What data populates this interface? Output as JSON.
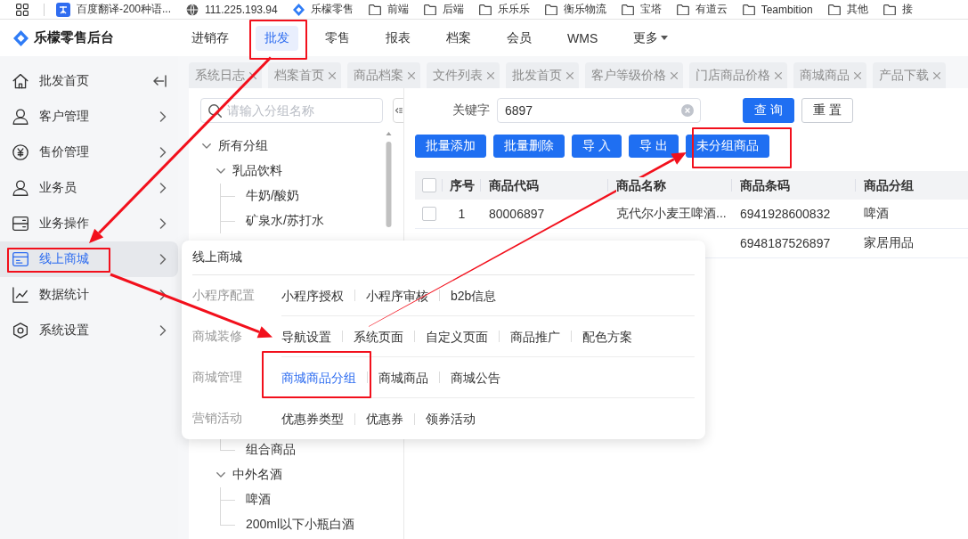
{
  "bookmarks_bar": {
    "items": [
      {
        "kind": "page",
        "label": "百度翻译-200种语..."
      },
      {
        "kind": "page",
        "label": "111.225.193.94"
      },
      {
        "kind": "page",
        "label": "乐檬零售"
      },
      {
        "kind": "folder",
        "label": "前端"
      },
      {
        "kind": "folder",
        "label": "后端"
      },
      {
        "kind": "folder",
        "label": "乐乐乐"
      },
      {
        "kind": "folder",
        "label": "衡乐物流"
      },
      {
        "kind": "folder",
        "label": "宝塔"
      },
      {
        "kind": "folder",
        "label": "有道云"
      },
      {
        "kind": "folder",
        "label": "Teambition"
      },
      {
        "kind": "folder",
        "label": "其他"
      },
      {
        "kind": "folder",
        "label": "接"
      }
    ]
  },
  "header": {
    "title": "乐檬零售后台",
    "nav": [
      {
        "label": "进销存",
        "kind": "link",
        "selected": false,
        "highlighted": false
      },
      {
        "label": "批发",
        "kind": "link",
        "selected": true,
        "highlighted": true
      },
      {
        "label": "零售",
        "kind": "link",
        "selected": false,
        "highlighted": false
      },
      {
        "label": "报表",
        "kind": "link",
        "selected": false,
        "highlighted": false
      },
      {
        "label": "档案",
        "kind": "link",
        "selected": false,
        "highlighted": false
      },
      {
        "label": "会员",
        "kind": "link",
        "selected": false,
        "highlighted": false
      },
      {
        "label": "WMS",
        "kind": "link",
        "selected": false,
        "highlighted": false
      },
      {
        "label": "更多",
        "kind": "menu",
        "selected": false,
        "highlighted": false
      }
    ]
  },
  "sidebar": {
    "items": [
      {
        "label": "批发首页",
        "selected": false,
        "highlighted": false
      },
      {
        "label": "客户管理",
        "selected": false,
        "highlighted": false
      },
      {
        "label": "售价管理",
        "selected": false,
        "highlighted": false
      },
      {
        "label": "业务员",
        "selected": false,
        "highlighted": false
      },
      {
        "label": "业务操作",
        "selected": false,
        "highlighted": false
      },
      {
        "label": "线上商城",
        "selected": true,
        "highlighted": true
      },
      {
        "label": "数据统计",
        "selected": false,
        "highlighted": false
      },
      {
        "label": "系统设置",
        "selected": false,
        "highlighted": false
      }
    ]
  },
  "tabs": [
    {
      "label": "系统日志",
      "closable": true
    },
    {
      "label": "档案首页",
      "closable": true
    },
    {
      "label": "商品档案",
      "closable": true
    },
    {
      "label": "文件列表",
      "closable": true
    },
    {
      "label": "批发首页",
      "closable": true
    },
    {
      "label": "客户等级价格",
      "closable": true
    },
    {
      "label": "门店商品价格",
      "closable": true
    },
    {
      "label": "商城商品",
      "closable": true
    },
    {
      "label": "产品下载",
      "closable": true
    }
  ],
  "group_panel": {
    "search": {
      "placeholder": "请输入分组名称"
    },
    "tree": [
      {
        "label": "所有分组",
        "expanded": true,
        "children": [
          {
            "label": "乳品饮料",
            "expanded": true,
            "children": [
              {
                "label": "牛奶/酸奶"
              },
              {
                "label": "矿泉水/苏打水"
              },
              {
                "label": "组合商品"
              }
            ]
          },
          {
            "label": "中外名酒",
            "expanded": true,
            "children": [
              {
                "label": "啤酒"
              },
              {
                "label": "200ml以下小瓶白酒"
              }
            ]
          }
        ]
      }
    ]
  },
  "goods_panel": {
    "keyword": {
      "label": "关键字",
      "value": "6897"
    },
    "search_buttons": [
      {
        "label": "查 询",
        "kind": "primary"
      },
      {
        "label": "重 置",
        "kind": "default"
      }
    ],
    "toolbar": [
      {
        "label": "批量添加",
        "highlighted": false
      },
      {
        "label": "批量删除",
        "highlighted": false
      },
      {
        "label": "导 入",
        "highlighted": false
      },
      {
        "label": "导 出",
        "highlighted": false
      },
      {
        "label": "未分组商品",
        "highlighted": true
      }
    ],
    "table": {
      "columns": [
        "序号",
        "商品代码",
        "商品名称",
        "商品条码",
        "商品分组"
      ],
      "header_checked": false,
      "rows": [
        {
          "checked": false,
          "cells": [
            "1",
            "80006897",
            "克代尔小麦王啤酒...",
            "6941928600832",
            "啤酒"
          ]
        },
        {
          "cells": [
            null,
            null,
            null,
            "6948187526897",
            "家居用品"
          ]
        }
      ]
    }
  },
  "flyout_menu": {
    "title": "线上商城",
    "sections": [
      {
        "label": "小程序配置",
        "links": [
          {
            "label": "小程序授权",
            "selected": false,
            "highlighted": false
          },
          {
            "label": "小程序审核",
            "selected": false,
            "highlighted": false
          },
          {
            "label": "b2b信息",
            "selected": false,
            "highlighted": false
          }
        ]
      },
      {
        "label": "商城装修",
        "links": [
          {
            "label": "导航设置",
            "selected": false,
            "highlighted": false
          },
          {
            "label": "系统页面",
            "selected": false,
            "highlighted": false
          },
          {
            "label": "自定义页面",
            "selected": false,
            "highlighted": false
          },
          {
            "label": "商品推广",
            "selected": false,
            "highlighted": false
          },
          {
            "label": "配色方案",
            "selected": false,
            "highlighted": false
          }
        ]
      },
      {
        "label": "商城管理",
        "links": [
          {
            "label": "商城商品分组",
            "selected": true,
            "highlighted": true
          },
          {
            "label": "商城商品",
            "selected": false,
            "highlighted": false
          },
          {
            "label": "商城公告",
            "selected": false,
            "highlighted": false
          }
        ]
      },
      {
        "label": "营销活动",
        "links": [
          {
            "label": "优惠券类型",
            "selected": false,
            "highlighted": false
          },
          {
            "label": "优惠券",
            "selected": false,
            "highlighted": false
          },
          {
            "label": "领券活动",
            "selected": false,
            "highlighted": false
          }
        ]
      }
    ]
  }
}
